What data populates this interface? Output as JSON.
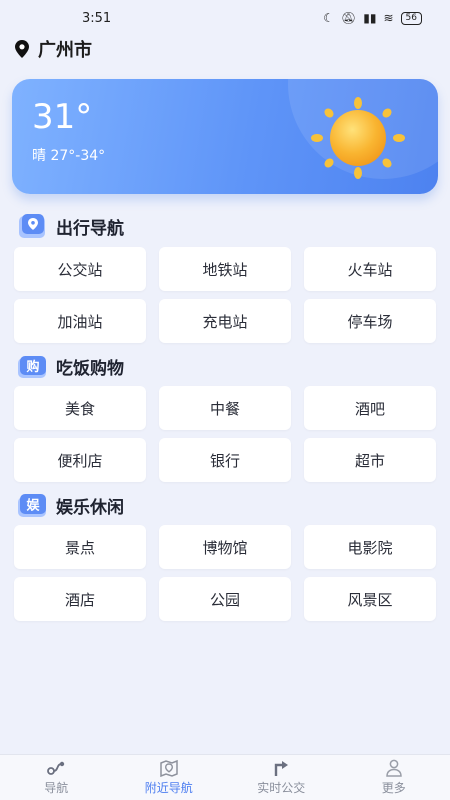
{
  "status": {
    "time": "3:51",
    "battery": "56"
  },
  "location": {
    "city": "广州市"
  },
  "weather": {
    "temperature": "31°",
    "description": "晴 27°-34°"
  },
  "sections": [
    {
      "title": "出行导航",
      "items": [
        "公交站",
        "地铁站",
        "火车站",
        "加油站",
        "充电站",
        "停车场"
      ]
    },
    {
      "title": "吃饭购物",
      "items": [
        "美食",
        "中餐",
        "酒吧",
        "便利店",
        "银行",
        "超市"
      ]
    },
    {
      "title": "娱乐休闲",
      "items": [
        "景点",
        "博物馆",
        "电影院",
        "酒店",
        "公园",
        "风景区"
      ]
    }
  ],
  "section_icons": [
    "map-navigation-icon",
    "shopping-bag-icon",
    "entertainment-icon"
  ],
  "section_icon_glyphs": [
    "",
    "购",
    "娱"
  ],
  "tabs": [
    {
      "label": "导航",
      "icon": "route-icon",
      "active": false
    },
    {
      "label": "附近导航",
      "icon": "nearby-map-icon",
      "active": true
    },
    {
      "label": "实时公交",
      "icon": "bus-route-icon",
      "active": false
    },
    {
      "label": "更多",
      "icon": "user-icon",
      "active": false
    }
  ],
  "colors": {
    "accent": "#4d7ef0",
    "card_gradient_start": "#7fb2ff",
    "card_gradient_end": "#4d82f0",
    "sun": "#f7a928"
  }
}
